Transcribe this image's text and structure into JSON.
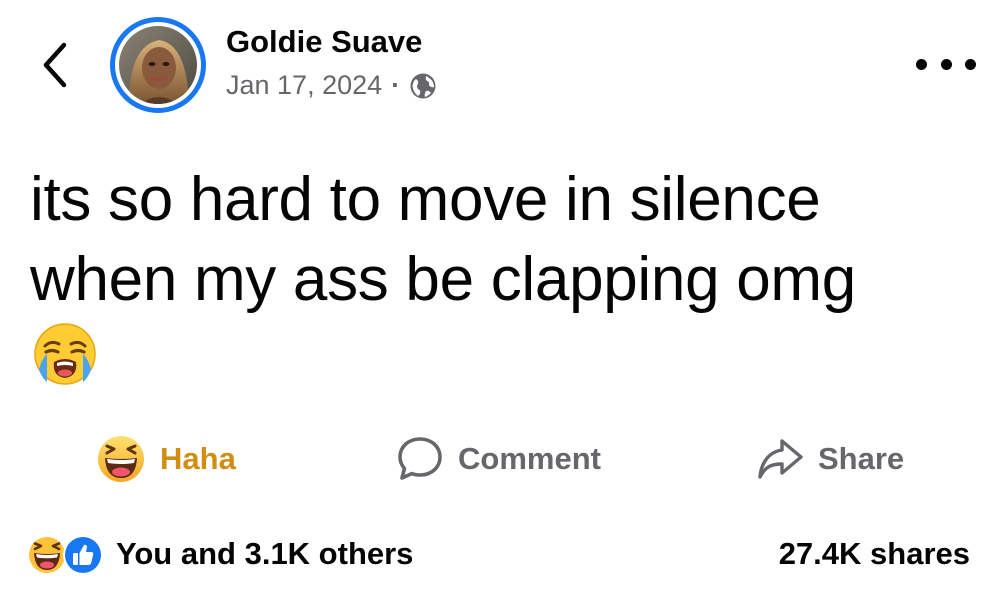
{
  "header": {
    "author_name": "Goldie Suave",
    "date": "Jan 17, 2024",
    "separator": "·",
    "audience_icon": "globe-icon",
    "back_icon": "chevron-left-icon",
    "more_icon": "more-horizontal-icon"
  },
  "post": {
    "text": "its so hard to move in silence when my ass be clapping omg",
    "emoji": "loudly-crying-face-emoji"
  },
  "actions": {
    "haha_label": "Haha",
    "comment_label": "Comment",
    "share_label": "Share"
  },
  "footer": {
    "reactions_text": "You and 3.1K others",
    "shares_text": "27.4K shares"
  },
  "colors": {
    "accent": "#1877f2",
    "haha": "#d18e12",
    "muted": "#65676b",
    "text": "#050505"
  }
}
